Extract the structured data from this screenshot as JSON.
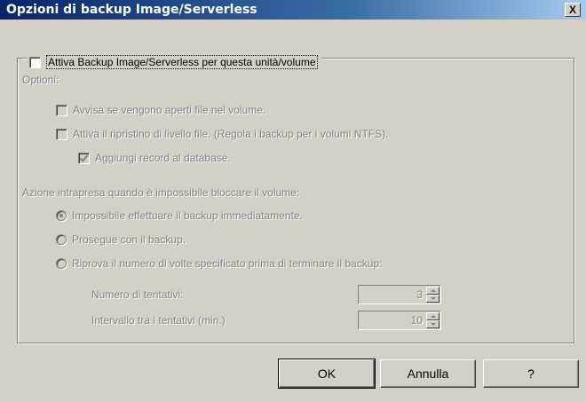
{
  "window": {
    "title": "Opzioni di backup Image/Serverless",
    "close_label": "X"
  },
  "enable": {
    "label": "Attiva Backup Image/Serverless per questa unità/volume",
    "checked": false
  },
  "options": {
    "heading": "Optioni:",
    "warn_open_files": {
      "label": "Avvisa se vengono aperti file nel volume.",
      "checked": false
    },
    "file_level_restore": {
      "label": "Attiva il ripristino di livello file. (Regola i backup per i volumi NTFS).",
      "checked": false
    },
    "add_db_records": {
      "label": "Aggiungi record al database.",
      "checked": true
    }
  },
  "action": {
    "heading": "Azione intrapresa quando è impossibile bloccare il volume:",
    "options": [
      {
        "label": "Impossibile effettuare il backup immediatamente.",
        "selected": true
      },
      {
        "label": "Prosegue con il backup.",
        "selected": false
      },
      {
        "label": "Riprova il numero di volte specificato prima di terminare il backup:",
        "selected": false
      }
    ],
    "retries": {
      "label": "Numero di tentativi:",
      "value": "3"
    },
    "interval": {
      "label": "Intervallo tra i tentativi (min.)",
      "value": "10"
    }
  },
  "buttons": {
    "ok": "OK",
    "cancel": "Annulla",
    "help": "?"
  }
}
